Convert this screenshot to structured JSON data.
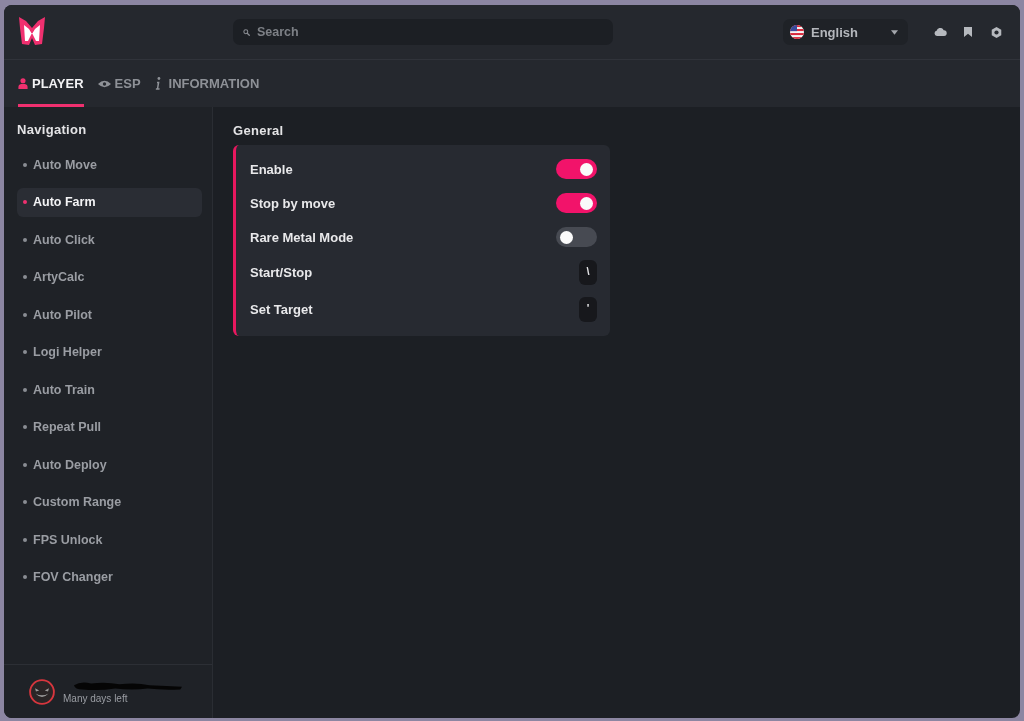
{
  "header": {
    "search": {
      "placeholder": "Search"
    },
    "language": {
      "label": "English"
    }
  },
  "tabs": [
    {
      "label": "PLAYER",
      "selected": true
    },
    {
      "label": "ESP",
      "selected": false
    },
    {
      "label": "INFORMATION",
      "selected": false
    }
  ],
  "sidebar": {
    "title": "Navigation",
    "items": [
      {
        "label": "Auto Move",
        "selected": false
      },
      {
        "label": "Auto Farm",
        "selected": true
      },
      {
        "label": "Auto Click",
        "selected": false
      },
      {
        "label": "ArtyCalc",
        "selected": false
      },
      {
        "label": "Auto Pilot",
        "selected": false
      },
      {
        "label": "Logi Helper",
        "selected": false
      },
      {
        "label": "Auto Train",
        "selected": false
      },
      {
        "label": "Repeat Pull",
        "selected": false
      },
      {
        "label": "Auto Deploy",
        "selected": false
      },
      {
        "label": "Custom Range",
        "selected": false
      },
      {
        "label": "FPS Unlock",
        "selected": false
      },
      {
        "label": "FOV Changer",
        "selected": false
      }
    ],
    "user": {
      "status": "Many days left"
    }
  },
  "section": {
    "title": "General",
    "settings": [
      {
        "kind": "toggle",
        "label": "Enable",
        "on": true
      },
      {
        "kind": "toggle",
        "label": "Stop by move",
        "on": true
      },
      {
        "kind": "toggle",
        "label": "Rare Metal Mode",
        "on": false
      },
      {
        "kind": "keybind",
        "label": "Start/Stop",
        "key": "\\"
      },
      {
        "kind": "keybind",
        "label": "Set Target",
        "key": "'"
      }
    ]
  }
}
